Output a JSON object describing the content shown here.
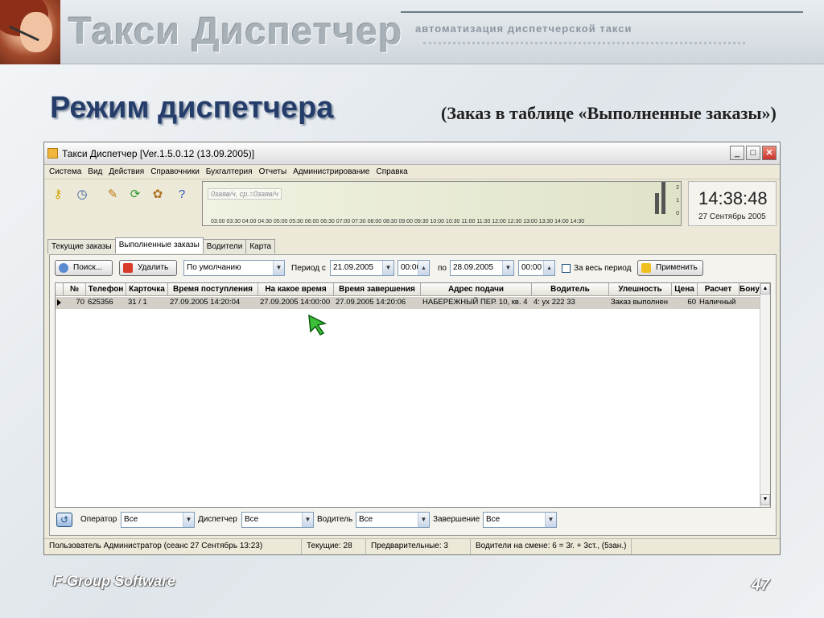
{
  "slide": {
    "brand_title": "Такси Диспетчер",
    "brand_subtitle": "автоматизация диспетчерской такси",
    "title": "Режим диспетчера",
    "subtitle": "(Заказ в таблице «Выполненные заказы»)",
    "footer": "F-Group Software",
    "page_number": "47"
  },
  "window": {
    "title": "Такси Диспетчер [Ver.1.5.0.12  (13.09.2005)]",
    "minimize": "_",
    "maximize": "□",
    "close": "✕"
  },
  "menu": [
    "Система",
    "Вид",
    "Действия",
    "Справочники",
    "Бухгалтерия",
    "Отчеты",
    "Администрирование",
    "Справка"
  ],
  "toolbar": {
    "icons": [
      "key-icon",
      "clock-icon",
      "edit-icon",
      "refresh-icon",
      "users-icon",
      "help-icon"
    ]
  },
  "graph": {
    "legend": "0заяв/ч, ср.=0заяв/ч",
    "time_ticks": "03:00 03:30 04:00 04:30 05:00 05:30 06:00 06:30 07:00 07:30 08:00 08:30 09:00 09:30 10:00 10:30 11:00 11:30 12:00 12:30 13:00 13:30 14:00 14:30",
    "y_axis": [
      "2",
      "1",
      "0"
    ]
  },
  "clock": {
    "time": "14:38:48",
    "date": "27 Сентябрь 2005"
  },
  "tabs": [
    "Текущие заказы",
    "Выполненные заказы",
    "Водители",
    "Карта"
  ],
  "filter": {
    "search_label": "Поиск...",
    "delete_label": "Удалить",
    "sort_value": "По умолчанию",
    "period_from_label": "Период с",
    "date_from": "21.09.2005",
    "time_from": "00:00",
    "period_to_label": "по",
    "date_to": "28.09.2005",
    "time_to": "00:00",
    "whole_period_label": "За весь период",
    "apply_label": "Применить"
  },
  "table": {
    "columns": [
      "№",
      "Телефон",
      "Карточка",
      "Время поступления",
      "На какое время",
      "Время завершения",
      "Адрес подачи",
      "Водитель",
      "Улешность",
      "Цена",
      "Расчет",
      "Бонус"
    ],
    "rows": [
      [
        "70",
        "625356",
        "31 / 1",
        "27.09.2005 14:20:04",
        "27.09.2005 14:00:00",
        "27.09.2005 14:20:06",
        "НАБЕРЕЖНЫЙ ПЕР. 10, кв. 4",
        "4: ух 222 33",
        "Заказ выполнен",
        "60",
        "Наличный",
        ""
      ]
    ]
  },
  "bottom_filter": {
    "operator_label": "Оператор",
    "operator_value": "Все",
    "dispatcher_label": "Диспетчер",
    "dispatcher_value": "Все",
    "driver_label": "Водитель",
    "driver_value": "Все",
    "completion_label": "Завершение",
    "completion_value": "Все"
  },
  "status": {
    "user": "Пользователь Администратор  (сеанс  27 Сентябрь  13:23)",
    "current": "Текущие: 28",
    "preliminary": "Предварительные: 3",
    "drivers": "Водители на смене: 6 = 3г. + 3ст., (5зан.)"
  }
}
